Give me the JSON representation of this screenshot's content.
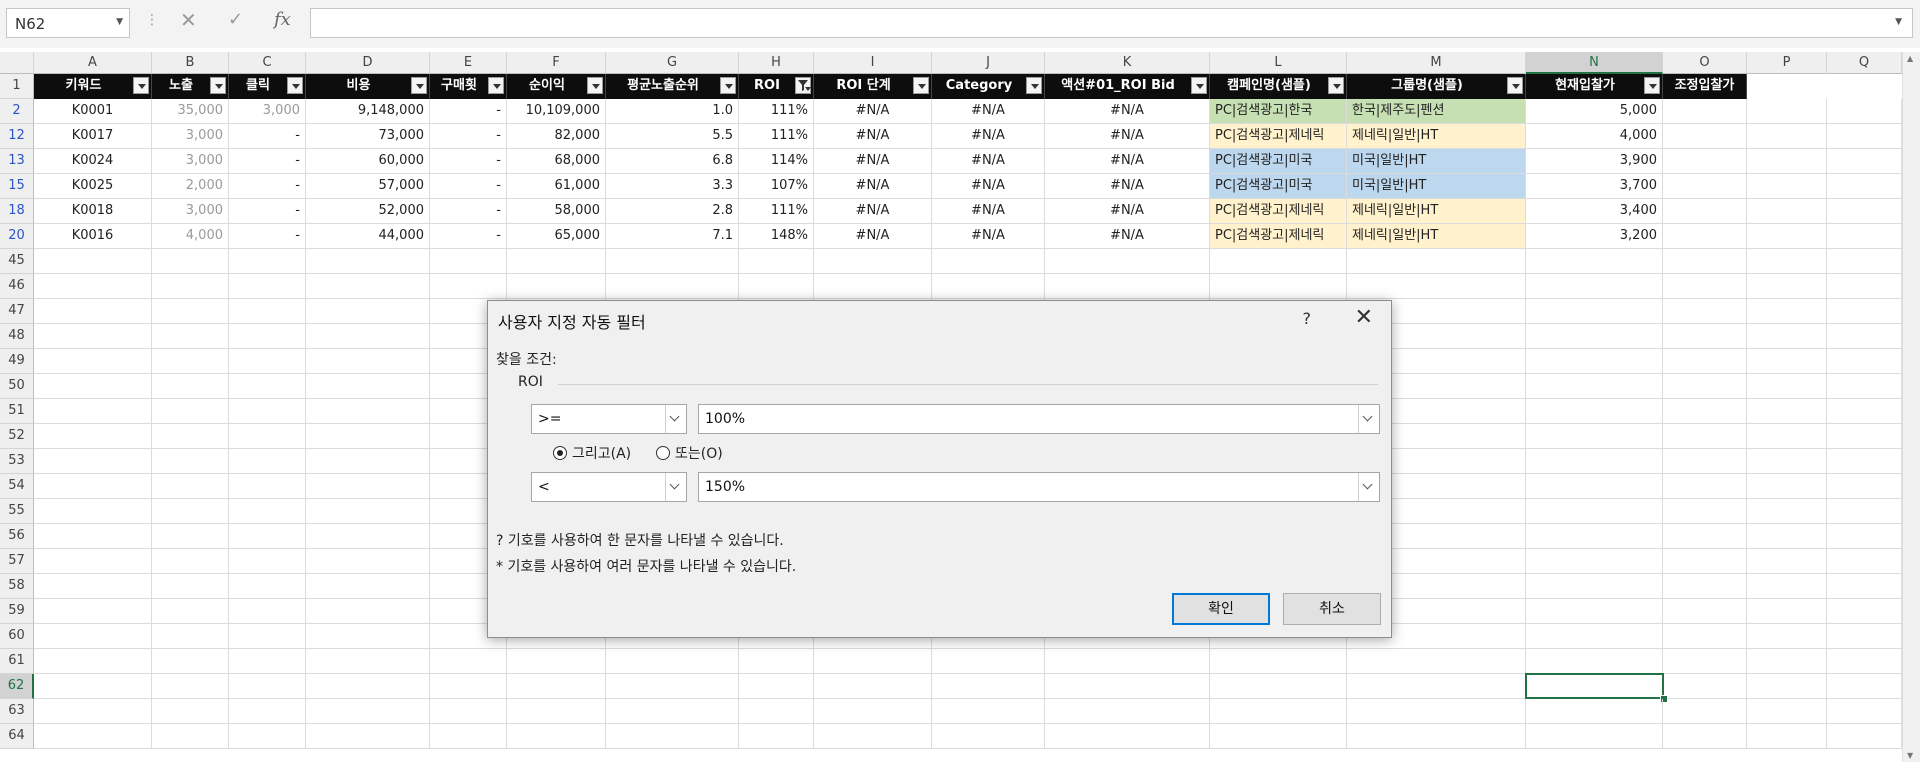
{
  "formula_bar": {
    "name_box": "N62",
    "cancel_icon": "✕",
    "enter_icon": "✓",
    "fx_label": "fx",
    "formula": ""
  },
  "columns": [
    "A",
    "B",
    "C",
    "D",
    "E",
    "F",
    "G",
    "H",
    "I",
    "J",
    "K",
    "L",
    "M",
    "N",
    "O",
    "P",
    "Q"
  ],
  "selected_column": "N",
  "header_row": {
    "row_number": "1",
    "cells": [
      {
        "col": "A",
        "label": "키워드",
        "filter": true
      },
      {
        "col": "B",
        "label": "노출",
        "filter": true
      },
      {
        "col": "C",
        "label": "클릭",
        "filter": true
      },
      {
        "col": "D",
        "label": "비용",
        "filter": true
      },
      {
        "col": "E",
        "label": "구매횟",
        "filter": true
      },
      {
        "col": "F",
        "label": "순이익",
        "filter": true
      },
      {
        "col": "G",
        "label": "평균노출순위",
        "filter": true
      },
      {
        "col": "H",
        "label": "ROI",
        "filter": true,
        "filter_active": true
      },
      {
        "col": "I",
        "label": "ROI 단계",
        "filter": true
      },
      {
        "col": "J",
        "label": "Category",
        "filter": true
      },
      {
        "col": "K",
        "label": "액션#01_ROI Bid",
        "filter": true
      },
      {
        "col": "L",
        "label": "캠페인명(샘플)",
        "filter": true
      },
      {
        "col": "M",
        "label": "그룹명(샘플)",
        "filter": true
      },
      {
        "col": "N",
        "label": "현재입찰가",
        "filter": true
      },
      {
        "col": "O",
        "label": "조정입찰가",
        "filter": false
      }
    ]
  },
  "data_rows": [
    {
      "row": "2",
      "A": "K0001",
      "B": "35,000",
      "C": "3,000",
      "D": "9,148,000",
      "E": "-",
      "F": "10,109,000",
      "G": "1.0",
      "H": "111%",
      "I": "#N/A",
      "J": "#N/A",
      "K": "#N/A",
      "L": "PC|검색광고|한국",
      "M": "한국|제주도|펜션",
      "N": "5,000",
      "fill": "green"
    },
    {
      "row": "12",
      "A": "K0017",
      "B": "3,000",
      "C": "-",
      "D": "73,000",
      "E": "-",
      "F": "82,000",
      "G": "5.5",
      "H": "111%",
      "I": "#N/A",
      "J": "#N/A",
      "K": "#N/A",
      "L": "PC|검색광고|제네릭",
      "M": "제네릭|일반|HT",
      "N": "4,000",
      "fill": "yellow"
    },
    {
      "row": "13",
      "A": "K0024",
      "B": "3,000",
      "C": "-",
      "D": "60,000",
      "E": "-",
      "F": "68,000",
      "G": "6.8",
      "H": "114%",
      "I": "#N/A",
      "J": "#N/A",
      "K": "#N/A",
      "L": "PC|검색광고|미국",
      "M": "미국|일반|HT",
      "N": "3,900",
      "fill": "blue"
    },
    {
      "row": "15",
      "A": "K0025",
      "B": "2,000",
      "C": "-",
      "D": "57,000",
      "E": "-",
      "F": "61,000",
      "G": "3.3",
      "H": "107%",
      "I": "#N/A",
      "J": "#N/A",
      "K": "#N/A",
      "L": "PC|검색광고|미국",
      "M": "미국|일반|HT",
      "N": "3,700",
      "fill": "blue"
    },
    {
      "row": "18",
      "A": "K0018",
      "B": "3,000",
      "C": "-",
      "D": "52,000",
      "E": "-",
      "F": "58,000",
      "G": "2.8",
      "H": "111%",
      "I": "#N/A",
      "J": "#N/A",
      "K": "#N/A",
      "L": "PC|검색광고|제네릭",
      "M": "제네릭|일반|HT",
      "N": "3,400",
      "fill": "yellow"
    },
    {
      "row": "20",
      "A": "K0016",
      "B": "4,000",
      "C": "-",
      "D": "44,000",
      "E": "-",
      "F": "65,000",
      "G": "7.1",
      "H": "148%",
      "I": "#N/A",
      "J": "#N/A",
      "K": "#N/A",
      "L": "PC|검색광고|제네릭",
      "M": "제네릭|일반|HT",
      "N": "3,200",
      "fill": "yellow"
    }
  ],
  "empty_rows": [
    "45",
    "46",
    "47",
    "48",
    "49",
    "50",
    "51",
    "52",
    "53",
    "54",
    "55",
    "56",
    "57",
    "58",
    "59",
    "60",
    "61",
    "62",
    "63",
    "64"
  ],
  "selected_row": "62",
  "dialog": {
    "title": "사용자 지정 자동 필터",
    "help": "?",
    "close": "✕",
    "find_label": "찾을 조건:",
    "field_name": "ROI",
    "condition1_op": ">=",
    "condition1_value": "100%",
    "radio_and": "그리고(A)",
    "radio_or": "또는(O)",
    "selected_radio": "and",
    "condition2_op": "<",
    "condition2_value": "150%",
    "hint1": "? 기호를 사용하여 한 문자를 나타낼 수 있습니다.",
    "hint2": "* 기호를 사용하여 여러 문자를 나타낼 수 있습니다.",
    "ok": "확인",
    "cancel": "취소"
  },
  "colors": {
    "header_bg": "#0d0d0d",
    "green": "#c6e0b4",
    "yellow": "#fff2cc",
    "blue": "#bdd7ee",
    "accent": "#217346"
  }
}
